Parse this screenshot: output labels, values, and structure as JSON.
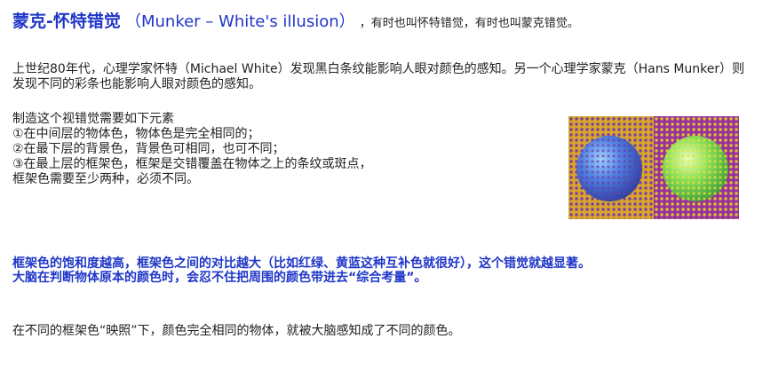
{
  "title": {
    "cn": "蒙克-怀特错觉",
    "en": "（Munker – White's illusion）",
    "note": "，有时也叫怀特错觉，有时也叫蒙克错觉。"
  },
  "intro": "上世纪80年代，心理学家怀特（Michael White）发现黑白条纹能影响人眼对颜色的感知。另一个心理学家蒙克（Hans Munker）则发现不同的彩条也能影响人眼对颜色的感知。",
  "elements": {
    "heading": "制造这个视错觉需要如下元素",
    "item1": "①在中间层的物体色，物体色是完全相同的；",
    "item2": "②在最下层的背景色，背景色可相同，也可不同；",
    "item3a": "③在最上层的框架色，框架是交错覆盖在物体之上的条纹或斑点，",
    "item3b": "框架色需要至少两种，必须不同。"
  },
  "emphasis": {
    "line1": "框架色的饱和度越高，框架色之间的对比越大（比如红绿、黄蓝这种互补色就很好），这个错觉就越显著。",
    "line2": "大脑在判断物体原本的颜色时，会忍不住把周围的颜色带进去“综合考量”。"
  },
  "conclusion": "在不同的框架色“映照”下，颜色完全相同的物体，就被大脑感知成了不同的颜色。",
  "colors": {
    "accent": "#1f36c8",
    "left_background": "#d9a62a",
    "right_background": "#9a2fa0",
    "left_dots": "#7a3fa6",
    "right_dots": "#d9c82a"
  }
}
